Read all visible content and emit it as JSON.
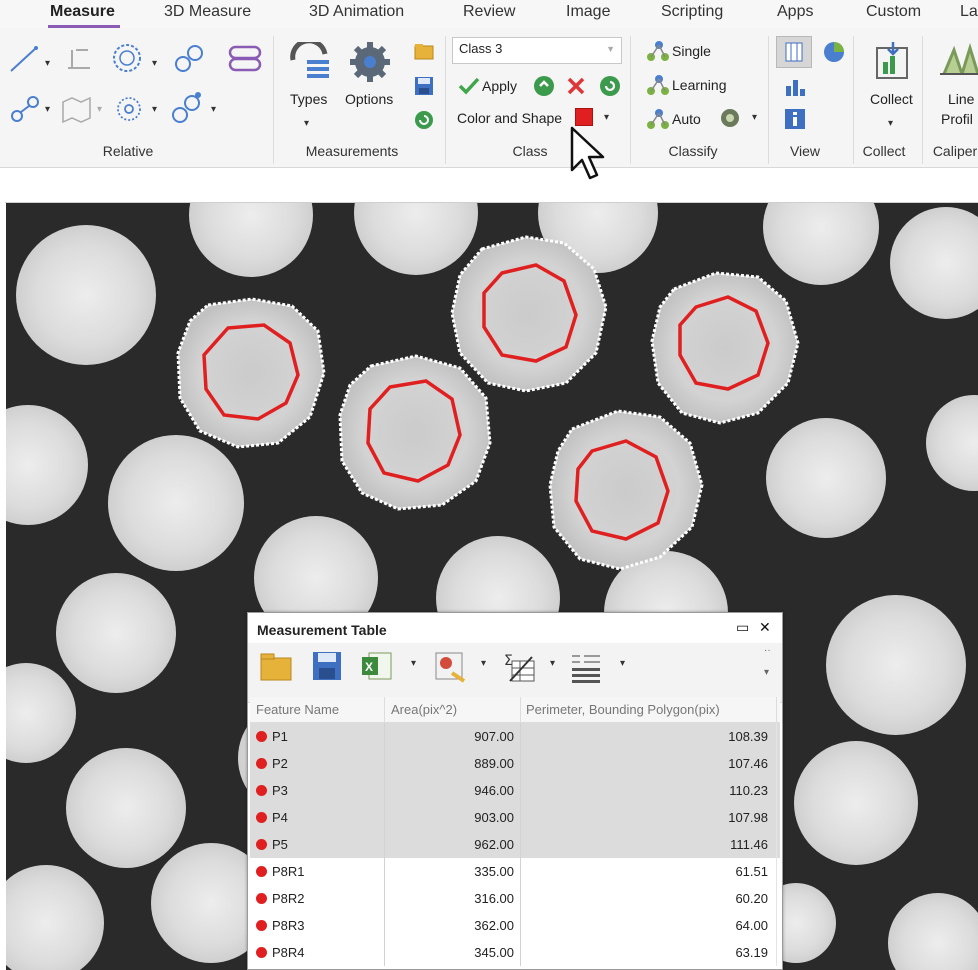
{
  "menu": {
    "tabs": [
      "Measure",
      "3D Measure",
      "3D Animation",
      "Review",
      "Image",
      "Scripting",
      "Apps",
      "Custom",
      "La"
    ],
    "active": "Measure"
  },
  "ribbon": {
    "relative": {
      "label": "Relative"
    },
    "measurements": {
      "label": "Measurements",
      "types_label": "Types",
      "options_label": "Options"
    },
    "class": {
      "label": "Class",
      "selected": "Class 3",
      "apply_label": "Apply",
      "color_shape_label": "Color and Shape",
      "swatch_color": "#e02020"
    },
    "classify": {
      "label": "Classify",
      "single_label": "Single",
      "learning_label": "Learning",
      "auto_label": "Auto"
    },
    "view": {
      "label": "View"
    },
    "collect": {
      "label": "Collect",
      "button_label": "Collect"
    },
    "caliper": {
      "label": "Caliper",
      "line_label": "Line",
      "profile_label": "Profil"
    }
  },
  "measurement_table": {
    "title": "Measurement Table",
    "columns": [
      "Feature Name",
      "Area(pix^2)",
      "Perimeter, Bounding Polygon(pix)"
    ],
    "rows": [
      {
        "name": "P1",
        "area": "907.00",
        "perimeter": "108.39",
        "selected": true
      },
      {
        "name": "P2",
        "area": "889.00",
        "perimeter": "107.46",
        "selected": true
      },
      {
        "name": "P3",
        "area": "946.00",
        "perimeter": "110.23",
        "selected": true
      },
      {
        "name": "P4",
        "area": "903.00",
        "perimeter": "107.98",
        "selected": true
      },
      {
        "name": "P5",
        "area": "962.00",
        "perimeter": "111.46",
        "selected": true
      },
      {
        "name": "P8R1",
        "area": "335.00",
        "perimeter": "61.51",
        "selected": false
      },
      {
        "name": "P8R2",
        "area": "316.00",
        "perimeter": "60.20",
        "selected": false
      },
      {
        "name": "P8R3",
        "area": "362.00",
        "perimeter": "64.00",
        "selected": false
      },
      {
        "name": "P8R4",
        "area": "345.00",
        "perimeter": "63.19",
        "selected": false
      }
    ]
  },
  "colors": {
    "accent_underline": "#8a5bb5",
    "measure_outline": "#e02020",
    "feature_dot": "#e02020"
  }
}
